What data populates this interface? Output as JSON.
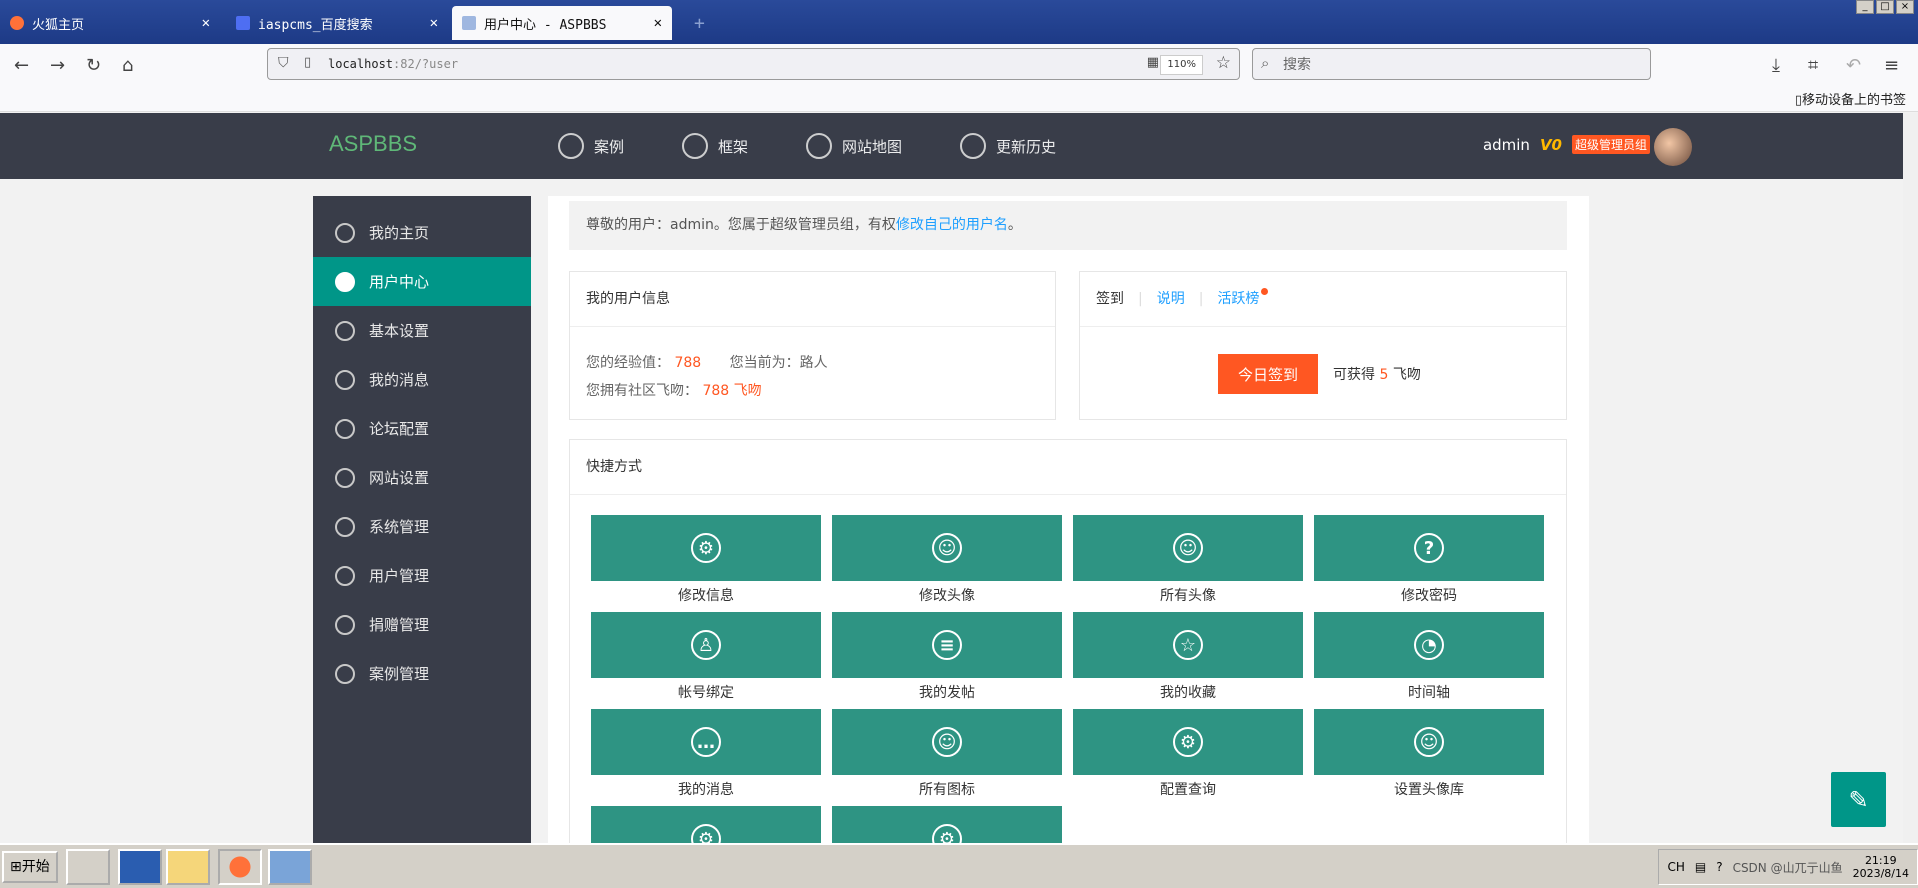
{
  "browser": {
    "tabs": [
      {
        "title": "火狐主页"
      },
      {
        "title": "iaspcms_百度搜索"
      },
      {
        "title": "用户中心 - ASPBBS"
      }
    ],
    "url_host": "localhost",
    "url_rest": ":82/?user",
    "zoom": "110%",
    "search_placeholder": "搜索",
    "mobile_bookmarks": "移动设备上的书签"
  },
  "site": {
    "logo": "ASPBBS",
    "nav": [
      {
        "label": "案例",
        "icon": "crown-icon"
      },
      {
        "label": "框架",
        "icon": "ui-icon"
      },
      {
        "label": "网站地图",
        "icon": "globe-icon"
      },
      {
        "label": "更新历史",
        "icon": "clock-icon"
      }
    ],
    "username": "admin",
    "vip": "V0",
    "role": "超级管理员组"
  },
  "sidebar": {
    "items": [
      {
        "label": "我的主页",
        "icon": "paper-plane-icon"
      },
      {
        "label": "用户中心",
        "icon": "user-icon"
      },
      {
        "label": "基本设置",
        "icon": "gear-icon"
      },
      {
        "label": "我的消息",
        "icon": "chat-icon"
      },
      {
        "label": "论坛配置",
        "icon": "gear-icon"
      },
      {
        "label": "网站设置",
        "icon": "globe-icon"
      },
      {
        "label": "系统管理",
        "icon": "gear-icon"
      },
      {
        "label": "用户管理",
        "icon": "user-icon"
      },
      {
        "label": "捐赠管理",
        "icon": "yen-icon"
      },
      {
        "label": "案例管理",
        "icon": "book-icon"
      }
    ],
    "active_index": 1
  },
  "welcome": {
    "prefix": "尊敬的用户：admin。您属于超级管理员组，有权",
    "link": "修改自己的用户名",
    "suffix": "。"
  },
  "user_info": {
    "title": "我的用户信息",
    "exp_label": "您的经验值：",
    "exp_value": "788",
    "level_label": "您当前为：路人",
    "kiss_label": "您拥有社区飞吻：",
    "kiss_value": "788 飞吻"
  },
  "sign": {
    "tab_sign": "签到",
    "tab_explain": "说明",
    "tab_rank": "活跃榜",
    "button": "今日签到",
    "reward_prefix": "可获得",
    "reward_value": "5",
    "reward_suffix": "飞吻"
  },
  "quick": {
    "title": "快捷方式",
    "tiles": [
      {
        "label": "修改信息",
        "icon": "gear-icon",
        "glyph": "⚙"
      },
      {
        "label": "修改头像",
        "icon": "smile-icon",
        "glyph": "☺"
      },
      {
        "label": "所有头像",
        "icon": "smile-icon",
        "glyph": "☺"
      },
      {
        "label": "修改密码",
        "icon": "question-icon",
        "glyph": "?"
      },
      {
        "label": "帐号绑定",
        "icon": "user-icon",
        "glyph": "♙"
      },
      {
        "label": "我的发帖",
        "icon": "document-icon",
        "glyph": "≡"
      },
      {
        "label": "我的收藏",
        "icon": "star-icon",
        "glyph": "☆"
      },
      {
        "label": "时间轴",
        "icon": "clock-icon",
        "glyph": "◔"
      },
      {
        "label": "我的消息",
        "icon": "chat-icon",
        "glyph": "…"
      },
      {
        "label": "所有图标",
        "icon": "smile-icon",
        "glyph": "☺"
      },
      {
        "label": "配置查询",
        "icon": "gear-icon",
        "glyph": "⚙"
      },
      {
        "label": "设置头像库",
        "icon": "smile-icon",
        "glyph": "☺"
      },
      {
        "label": "",
        "icon": "gear-icon",
        "glyph": "⚙"
      },
      {
        "label": "",
        "icon": "gear-icon",
        "glyph": "⚙"
      }
    ]
  },
  "taskbar": {
    "start": "开始",
    "lang": "CH",
    "time": "21:19",
    "date": "2023/8/14",
    "watermark": "CSDN @山兀亍山鱼"
  },
  "colors": {
    "accent": "#009688",
    "tile": "#2e9483",
    "orange": "#ff5722",
    "header": "#393d49"
  }
}
